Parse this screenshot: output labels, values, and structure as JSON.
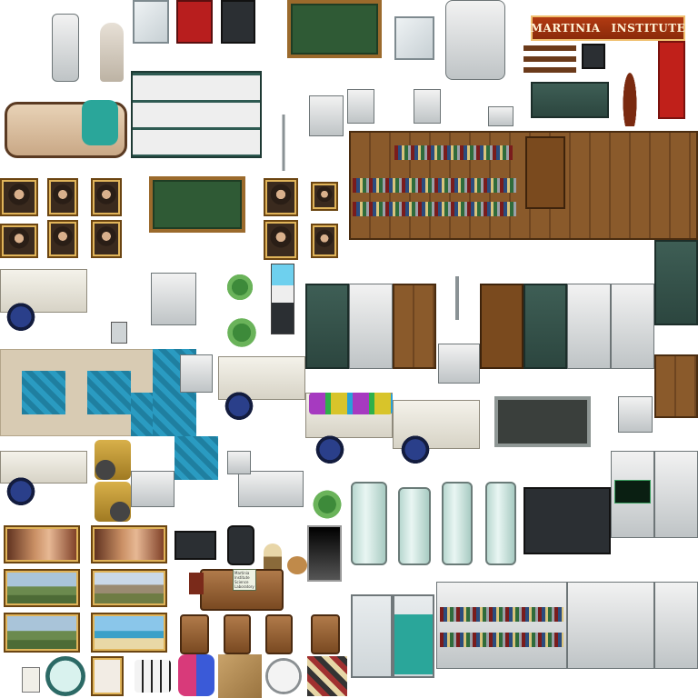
{
  "tileset": {
    "sign_text": "MARTINIA",
    "sign_text_2": "INSTITUTE",
    "note_lines": [
      "Martinia",
      "Institute",
      "Science",
      "Laboratory"
    ]
  },
  "icons": {
    "sign_emblem": "shield-icon"
  },
  "colors": {
    "chalkboard": "#2f5a35",
    "wood": "#8a5a2b",
    "water": "#2a9bc1",
    "banner": "#c0201a",
    "locker": "#3e5e55"
  }
}
